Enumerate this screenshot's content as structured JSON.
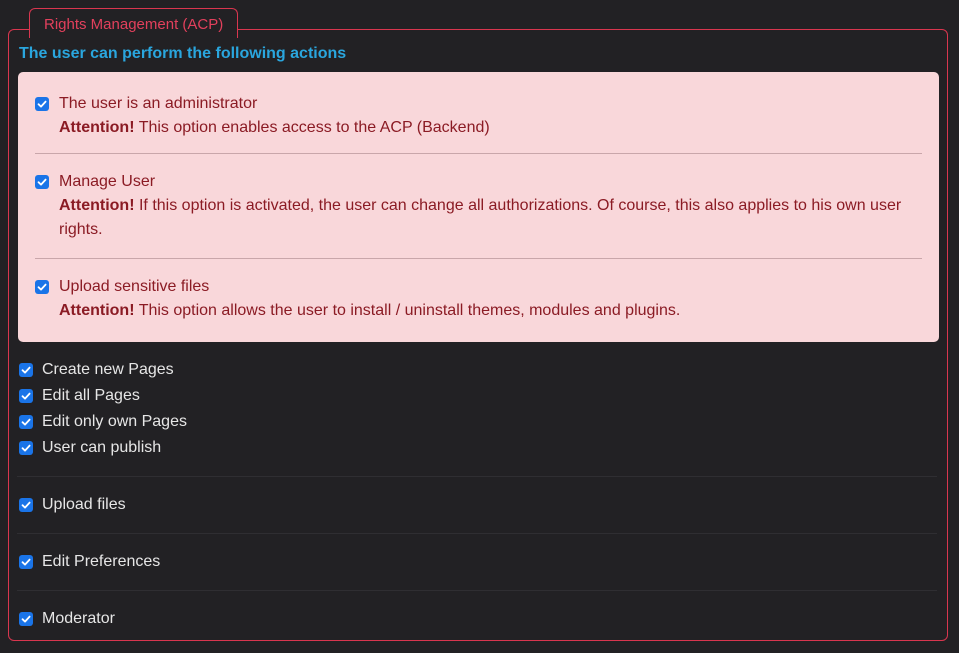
{
  "fieldset": {
    "legend": "Rights Management (ACP)",
    "heading": "The user can perform the following actions"
  },
  "alert_items": [
    {
      "label": "The user is an administrator",
      "attention": "Attention!",
      "description": "This option enables access to the ACP (Backend)",
      "checked": true
    },
    {
      "label": "Manage User",
      "attention": "Attention!",
      "description": "If this option is activated, the user can change all authorizations. Of course, this also applies to his own user rights.",
      "checked": true
    },
    {
      "label": "Upload sensitive files",
      "attention": "Attention!",
      "description": "This option allows the user to install / uninstall themes, modules and plugins.",
      "checked": true
    }
  ],
  "pages_group": [
    {
      "label": "Create new Pages",
      "checked": true
    },
    {
      "label": "Edit all Pages",
      "checked": true
    },
    {
      "label": "Edit only own Pages",
      "checked": true
    },
    {
      "label": "User can publish",
      "checked": true
    }
  ],
  "other_items": [
    {
      "label": "Upload files",
      "checked": true
    },
    {
      "label": "Edit Preferences",
      "checked": true
    },
    {
      "label": "Moderator",
      "checked": true
    }
  ],
  "colors": {
    "accent": "#e2405c",
    "heading": "#2aa6de",
    "checkbox": "#1a74e8",
    "alert_bg": "#f9d7da",
    "alert_text": "#8b1b24"
  }
}
